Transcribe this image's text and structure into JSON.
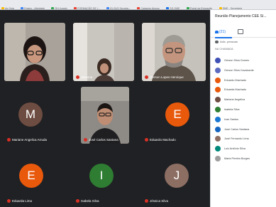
{
  "bookmarks": [
    {
      "label": "As Guia",
      "icon": "folder-icon"
    },
    {
      "label": "Ensino - Atividade",
      "icon": "bookmark-icon"
    },
    {
      "label": "RH Jurado",
      "icon": "bookmark-icon"
    },
    {
      "label": "FORMAÇÃO DE I...",
      "icon": "bookmark-icon"
    },
    {
      "label": "ID-SUS Secreta...",
      "icon": "bookmark-icon"
    },
    {
      "label": "Cadastro Alunos",
      "icon": "bookmark-icon"
    },
    {
      "label": "SG-SME",
      "icon": "bookmark-icon"
    },
    {
      "label": "Portal da Educação",
      "icon": "bookmark-icon"
    },
    {
      "label": "SME - Secretaria",
      "icon": "bookmark-icon"
    }
  ],
  "participants_tiles": [
    {
      "name": "",
      "avatar_letter": "",
      "kind": "camera"
    },
    {
      "name": "Sistema",
      "avatar_letter": "",
      "kind": "camera"
    },
    {
      "name": "Gerson Lopes Henrique",
      "avatar_letter": "",
      "kind": "camera"
    },
    {
      "name": "Mariane Angelica Arruda",
      "avatar_letter": "M",
      "kind": "avatar",
      "color": "#6d4c41"
    },
    {
      "name": "José Carlos Santana",
      "avatar_letter": "",
      "kind": "camera"
    },
    {
      "name": "Eduardo Machado",
      "avatar_letter": "E",
      "kind": "avatar",
      "color": "#e8590c"
    },
    {
      "name": "Eduarda Lima",
      "avatar_letter": "E",
      "kind": "avatar",
      "color": "#e8590c"
    },
    {
      "name": "Isabela Silva",
      "avatar_letter": "I",
      "kind": "avatar",
      "color": "#2e7d32"
    },
    {
      "name": "Jéssica Silva",
      "avatar_letter": "J",
      "kind": "avatar",
      "color": "#8d6e63"
    }
  ],
  "panel": {
    "title": "Reunião Planejamento CEE Sí...",
    "tab_people_label": "(21)",
    "tab_chat_icon": "chat-icon",
    "add_people_label": "Adic. pessoas",
    "section_label": "NA CHAMADA",
    "people": [
      {
        "name": "Gerson Silva Gomes",
        "color": "#3f51b5"
      },
      {
        "name": "Gerson Silva Cavalcante",
        "color": "#5c6bc0"
      },
      {
        "name": "Eduardo Machado",
        "color": "#e8590c"
      },
      {
        "name": "Eduarda Machado",
        "color": "#e8590c"
      },
      {
        "name": "Mariane Angelica",
        "color": "#6d4c41"
      },
      {
        "name": "Isabela Silva",
        "color": "#2e7d32"
      },
      {
        "name": "Ivan Santos",
        "color": "#1976d2"
      },
      {
        "name": "José Carlos Santana",
        "color": "#1565c0"
      },
      {
        "name": "José Fernando Lima",
        "color": "#8d6e63"
      },
      {
        "name": "Luiz Antônio Silva",
        "color": "#00897b"
      },
      {
        "name": "Maria Pereira Borges",
        "color": "#9e9e9e"
      }
    ]
  }
}
